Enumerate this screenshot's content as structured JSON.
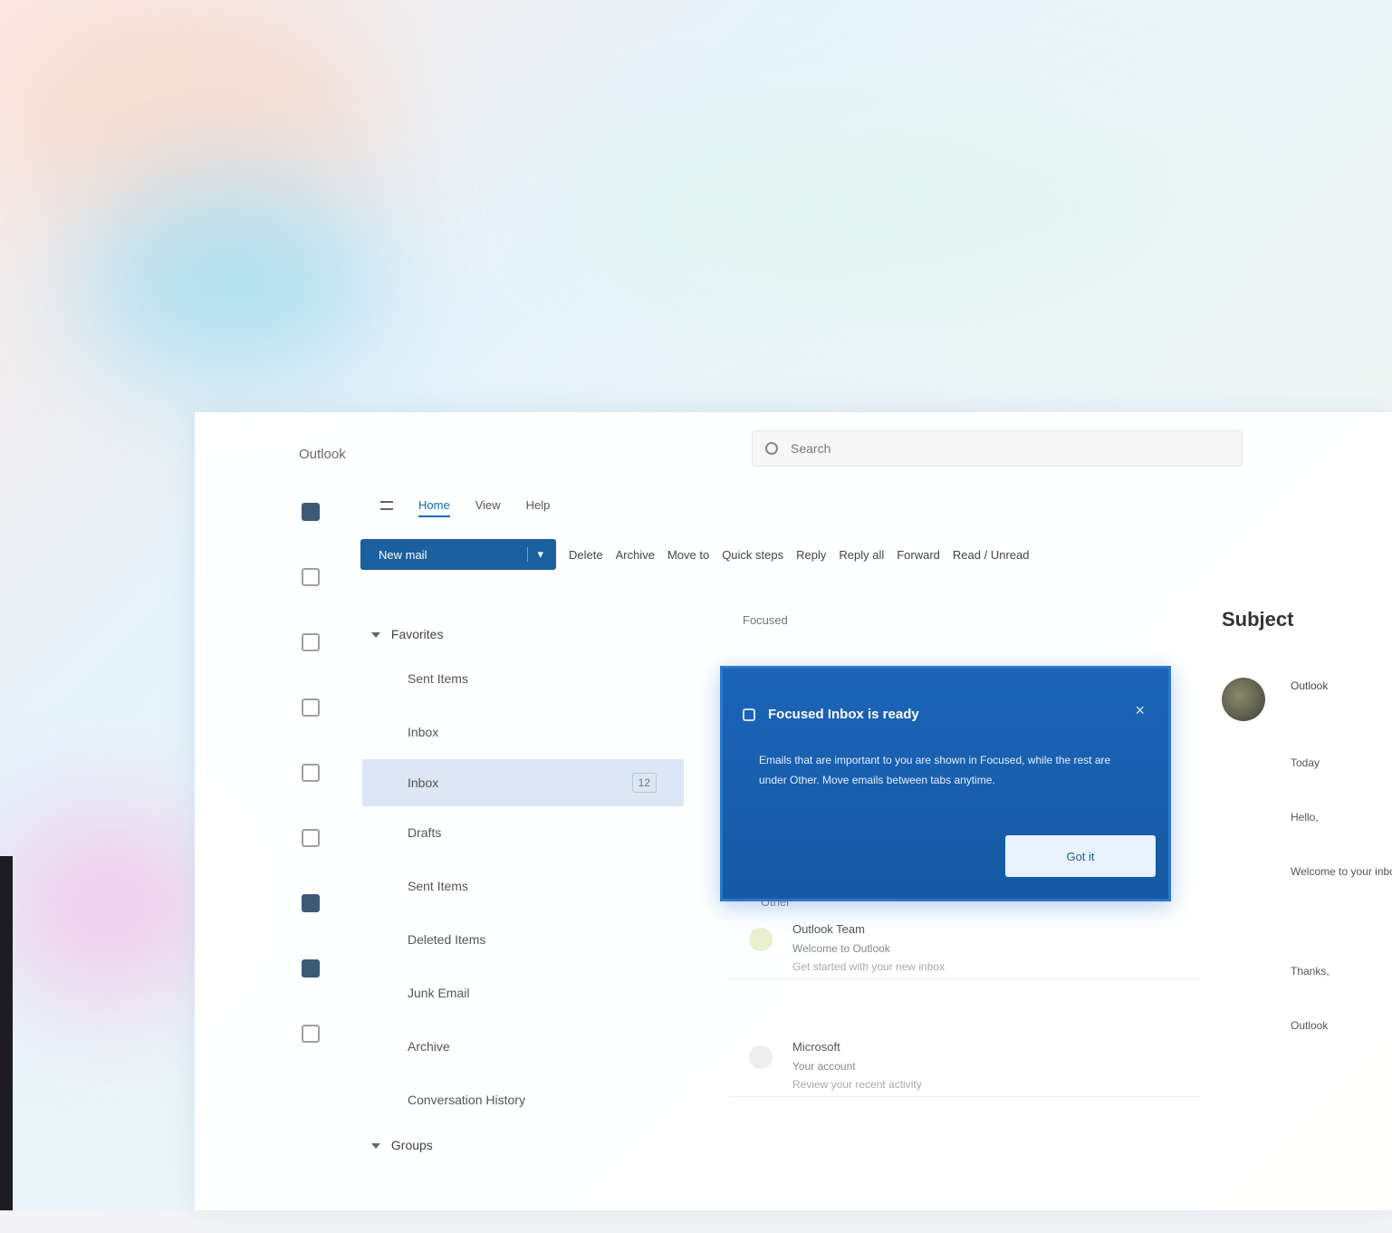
{
  "app": {
    "title": "Outlook",
    "search_placeholder": "Search"
  },
  "menu": {
    "tabs": [
      "Home",
      "View",
      "Help"
    ],
    "active_index": 0
  },
  "ribbon": {
    "new_mail": "New mail",
    "items": [
      "Delete",
      "Archive",
      "Move to",
      "Quick steps",
      "Reply",
      "Reply all",
      "Forward",
      "Read / Unread"
    ]
  },
  "folders": {
    "favorites_header": "Favorites",
    "favorite_items": [
      "Sent Items",
      "Inbox"
    ],
    "selected_folder": "Inbox",
    "selected_count": "12",
    "account_items": [
      "Drafts",
      "Sent Items",
      "Deleted Items",
      "Junk Email",
      "Archive",
      "Conversation History"
    ],
    "groups_header": "Groups"
  },
  "message_list": {
    "filter_label": "Focused",
    "section_label": "Other",
    "rows": [
      {
        "sender": "Outlook Team",
        "subject": "Welcome to Outlook",
        "preview": "Get started with your new inbox"
      },
      {
        "sender": "Microsoft",
        "subject": "Your account",
        "preview": "Review your recent activity"
      }
    ]
  },
  "popup": {
    "title": "Focused Inbox is ready",
    "body": "Emails that are important to you are shown in Focused, while the rest are under Other. Move emails between tabs anytime.",
    "button": "Got it",
    "close": "×"
  },
  "reading_pane": {
    "subject": "Subject",
    "sender": "Outlook",
    "time": "Today",
    "lines": [
      "Hello,",
      "Welcome to your inbox.",
      "Thanks,",
      "Outlook"
    ]
  },
  "colors": {
    "accent": "#1a5f9e",
    "popup_bg": "#1b63b8",
    "selected_bg": "#dce6f4"
  }
}
